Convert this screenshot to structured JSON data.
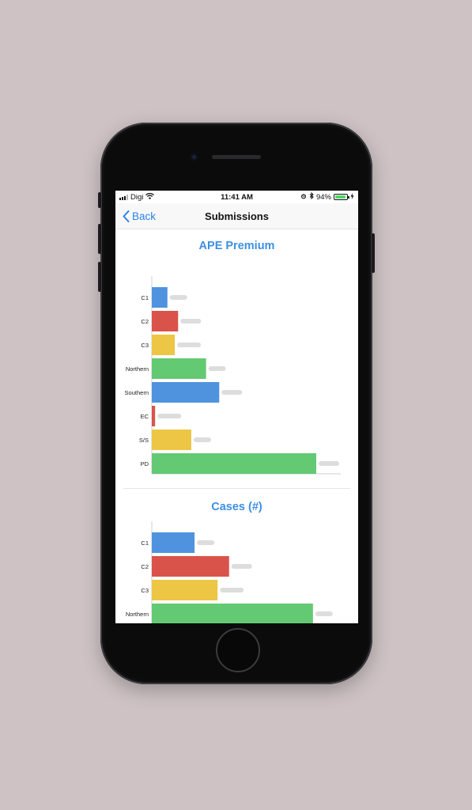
{
  "status": {
    "carrier": "Digi",
    "time": "11:41 AM",
    "battery_percent": "94%",
    "battery_level": 0.94
  },
  "nav": {
    "back_label": "Back",
    "title": "Submissions"
  },
  "colors": {
    "accent": "#3d8fe3",
    "blue": "#4f93de",
    "red": "#d9534a",
    "yellow": "#ecc644",
    "green": "#63c972"
  },
  "chart_data": [
    {
      "type": "bar",
      "orientation": "horizontal",
      "title": "APE Premium",
      "categories": [
        "C1",
        "C2",
        "C3",
        "Northern",
        "Southern",
        "EC",
        "S/S",
        "PD"
      ],
      "values": [
        9.5,
        16,
        14,
        33,
        41,
        2,
        24,
        100
      ],
      "colors": [
        "#4f93de",
        "#d9534a",
        "#ecc644",
        "#63c972",
        "#4f93de",
        "#d9534a",
        "#ecc644",
        "#63c972"
      ],
      "xlim": [
        0,
        100
      ],
      "grid": false,
      "data_labels_blurred": true
    },
    {
      "type": "bar",
      "orientation": "horizontal",
      "title": "Cases (#)",
      "categories": [
        "C1",
        "C2",
        "C3",
        "Northern"
      ],
      "values": [
        26,
        47,
        40,
        98
      ],
      "colors": [
        "#4f93de",
        "#d9534a",
        "#ecc644",
        "#63c972"
      ],
      "xlim": [
        0,
        100
      ],
      "grid": false,
      "data_labels_blurred": true
    }
  ]
}
